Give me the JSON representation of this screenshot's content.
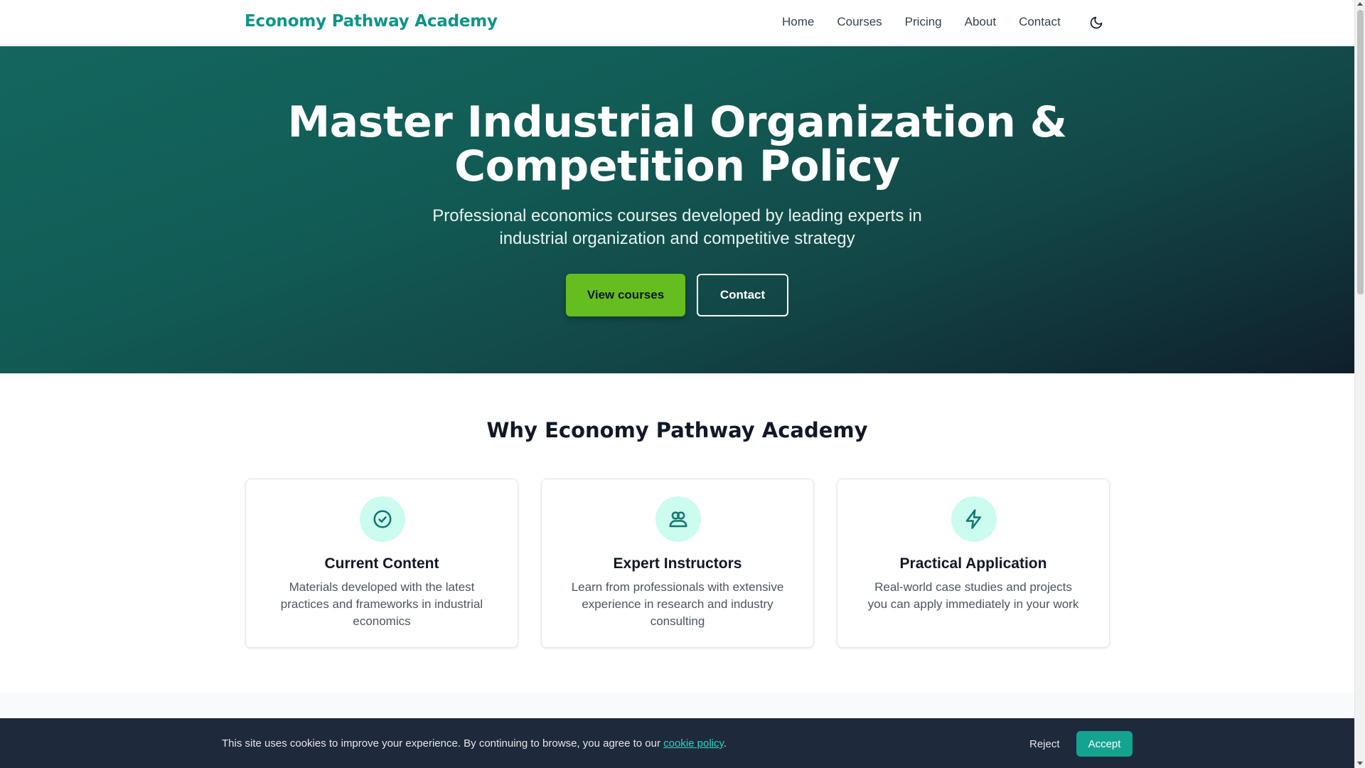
{
  "header": {
    "logo": "Economy Pathway Academy",
    "nav": [
      "Home",
      "Courses",
      "Pricing",
      "About",
      "Contact"
    ],
    "theme_icon": "moon-icon"
  },
  "hero": {
    "title_line1": "Master Industrial Organization &",
    "title_line2": "Competition Policy",
    "subtitle": "Professional economics courses developed by leading experts in industrial organization and competitive strategy",
    "primary_button": "View courses",
    "secondary_button": "Contact"
  },
  "features": {
    "title": "Why Economy Pathway Academy",
    "cards": [
      {
        "icon": "check-circle-icon",
        "title": "Current Content",
        "text": "Materials developed with the latest practices and frameworks in industrial economics"
      },
      {
        "icon": "users-icon",
        "title": "Expert Instructors",
        "text": "Learn from professionals with extensive experience in research and industry consulting"
      },
      {
        "icon": "lightning-icon",
        "title": "Practical Application",
        "text": "Real-world case studies and projects you can apply immediately in your work"
      }
    ]
  },
  "cookie": {
    "text_before": "This site uses cookies to improve your experience. By continuing to browse, you agree to our ",
    "link": "cookie policy",
    "text_after": ".",
    "reject": "Reject",
    "accept": "Accept"
  },
  "colors": {
    "brand": "#0d9488",
    "primary_button": "#65bd1f",
    "accept_button": "#14a38f",
    "hero_start": "#13675e",
    "hero_end": "#0f1f2b"
  }
}
